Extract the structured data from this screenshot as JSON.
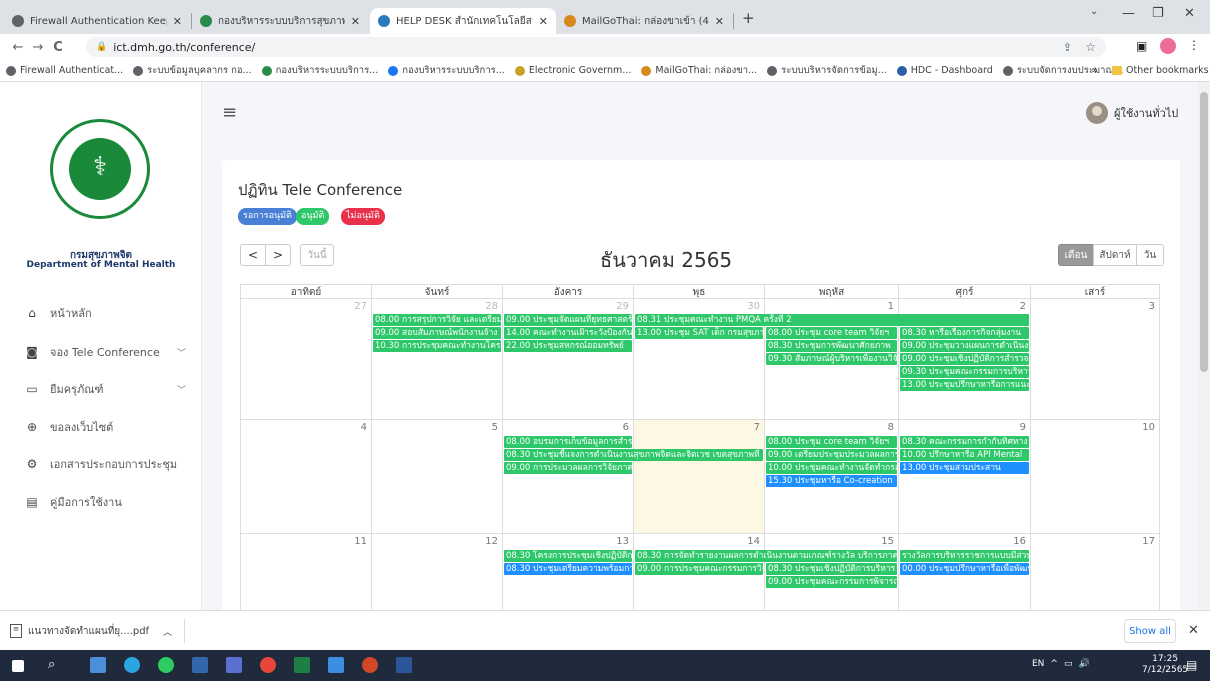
{
  "browser": {
    "tabs": [
      {
        "label": "Firewall Authentication Keepalive",
        "icon": "globe-icon",
        "active": false
      },
      {
        "label": "กองบริหารระบบบริการสุขภาพจิต",
        "icon": "site-icon",
        "active": false
      },
      {
        "label": "HELP DESK สำนักเทคโนโลยีสารสนเทศ",
        "icon": "helpdesk-icon",
        "active": true
      },
      {
        "label": "MailGoThai: กล่องขาเข้า (4)",
        "icon": "mail-icon",
        "active": false
      }
    ],
    "new_tab": "+",
    "url": "ict.dmh.go.th/conference/",
    "bookmarks": [
      "Firewall Authenticat...",
      "ระบบข้อมูลบุคลากร กอ...",
      "กองบริหารระบบบริการ...",
      "กองบริหารระบบบริการ...",
      "Electronic Governm...",
      "MailGoThai: กล่องขา...",
      "ระบบบริหารจัดการข้อมู...",
      "HDC - Dashboard",
      "ระบบจัดการงบประมาณ..."
    ],
    "bookmarks_more": "»",
    "other_bookmarks": "Other bookmarks"
  },
  "sidebar": {
    "dept_th": "กรมสุขภาพจิต",
    "dept_en": "Department of Mental Health",
    "items": [
      {
        "label": "หน้าหลัก",
        "icon": "home-icon",
        "has_sub": false
      },
      {
        "label": "จอง Tele Conference",
        "icon": "camera-icon",
        "has_sub": true
      },
      {
        "label": "ยืมครุภัณฑ์",
        "icon": "monitor-icon",
        "has_sub": true
      },
      {
        "label": "ขอลงเว็บไซต์",
        "icon": "web-icon",
        "has_sub": false
      },
      {
        "label": "เอกสารประกอบการประชุม",
        "icon": "gear-icon",
        "has_sub": false
      },
      {
        "label": "คู่มือการใช้งาน",
        "icon": "document-icon",
        "has_sub": false
      }
    ]
  },
  "header": {
    "menu_icon": "hamburger-icon",
    "user_label": "ผู้ใช้งานทั่วไป"
  },
  "calendar": {
    "title": "ปฏิทิน Tele Conference",
    "legend": [
      {
        "label": "รอการอนุมัติ",
        "color": "#4a7fd6"
      },
      {
        "label": "อนุมัติ",
        "color": "#2ec86a"
      },
      {
        "label": "ไม่อนุมัติ",
        "color": "#e8314a"
      }
    ],
    "prev": "<",
    "next": ">",
    "today_label": "วันนี้",
    "month_title": "ธันวาคม 2565",
    "views": [
      {
        "label": "เดือน",
        "active": true
      },
      {
        "label": "สัปดาห์",
        "active": false
      },
      {
        "label": "วัน",
        "active": false
      }
    ],
    "weekdays": [
      "อาทิตย์",
      "จันทร์",
      "อังคาร",
      "พุธ",
      "พฤหัส",
      "ศุกร์",
      "เสาร์"
    ],
    "weeks": [
      {
        "days": [
          {
            "n": "27",
            "other": true
          },
          {
            "n": "28",
            "other": true
          },
          {
            "n": "29",
            "other": true
          },
          {
            "n": "30",
            "other": true
          },
          {
            "n": "1"
          },
          {
            "n": "2"
          },
          {
            "n": "3"
          }
        ]
      },
      {
        "days": [
          {
            "n": "4"
          },
          {
            "n": "5"
          },
          {
            "n": "6"
          },
          {
            "n": "7",
            "today": true
          },
          {
            "n": "8"
          },
          {
            "n": "9"
          },
          {
            "n": "10"
          }
        ]
      },
      {
        "days": [
          {
            "n": "11"
          },
          {
            "n": "12"
          },
          {
            "n": "13"
          },
          {
            "n": "14"
          },
          {
            "n": "15"
          },
          {
            "n": "16"
          },
          {
            "n": "17"
          }
        ]
      }
    ],
    "events": [
      {
        "week": 0,
        "col": 1,
        "span": 1,
        "row": 0,
        "text": "08.00 การสรุปการวิจัย และเตรียม",
        "color": "g"
      },
      {
        "week": 0,
        "col": 2,
        "span": 1,
        "row": 0,
        "text": "09.00 ประชุมจัดแผนที่ยุทธศาสตร์",
        "color": "g"
      },
      {
        "week": 0,
        "col": 3,
        "span": 3,
        "row": 0,
        "text": "08.31 ประชุมคณะทำงาน PMQA ครั้งที่ 2",
        "color": "g"
      },
      {
        "week": 0,
        "col": 1,
        "span": 1,
        "row": 1,
        "text": "09.00 สอบสัมภาษณ์พนักงานจ้าง",
        "color": "g"
      },
      {
        "week": 0,
        "col": 2,
        "span": 1,
        "row": 1,
        "text": "14.00 คณะทำงานเฝ้าระวังป้องกัน",
        "color": "g"
      },
      {
        "week": 0,
        "col": 3,
        "span": 1,
        "row": 1,
        "text": "13.00 ประชุม SAT เด็ก กรมสุขภาพจิต",
        "color": "g"
      },
      {
        "week": 0,
        "col": 4,
        "span": 1,
        "row": 1,
        "text": "08.00 ประชุม core team วิจัยฯ",
        "color": "g"
      },
      {
        "week": 0,
        "col": 5,
        "span": 1,
        "row": 1,
        "text": "08.30 หารือเรื่องการกิจกลุ่มงาน",
        "color": "g"
      },
      {
        "week": 0,
        "col": 1,
        "span": 1,
        "row": 2,
        "text": "10.30 การประชุมคณะทำงานโครงการ",
        "color": "g"
      },
      {
        "week": 0,
        "col": 2,
        "span": 1,
        "row": 2,
        "text": "22.00 ประชุมสหกรณ์ออมทรัพย์",
        "color": "g"
      },
      {
        "week": 0,
        "col": 4,
        "span": 1,
        "row": 2,
        "text": "08.30 ประชุมการพัฒนาศักยภาพ",
        "color": "g"
      },
      {
        "week": 0,
        "col": 5,
        "span": 1,
        "row": 2,
        "text": "09.00 ประชุมวางแผนการดำเนินงาน",
        "color": "g"
      },
      {
        "week": 0,
        "col": 4,
        "span": 1,
        "row": 3,
        "text": "09.30 สัมภาษณ์ผู้บริหารเพื่องานวิจัย",
        "color": "g"
      },
      {
        "week": 0,
        "col": 5,
        "span": 1,
        "row": 3,
        "text": "09.00 ประชุมเชิงปฏิบัติการสำรวจ",
        "color": "g"
      },
      {
        "week": 0,
        "col": 5,
        "span": 1,
        "row": 4,
        "text": "09.30 ประชุมคณะกรรมการบริหาร",
        "color": "g"
      },
      {
        "week": 0,
        "col": 5,
        "span": 1,
        "row": 5,
        "text": "13.00 ประชุมปรึกษาหารือการแนะ",
        "color": "g"
      },
      {
        "week": 1,
        "col": 2,
        "span": 1,
        "row": 0,
        "text": "08.00 อบรมการเก็บข้อมูลการสำรวจ",
        "color": "g"
      },
      {
        "week": 1,
        "col": 4,
        "span": 1,
        "row": 0,
        "text": "08.00 ประชุม core team วิจัยฯ",
        "color": "g"
      },
      {
        "week": 1,
        "col": 5,
        "span": 1,
        "row": 0,
        "text": "08.30 คณะกรรมการกำกับทิศทาง",
        "color": "g"
      },
      {
        "week": 1,
        "col": 2,
        "span": 2,
        "row": 1,
        "text": "08.30 ประชุมชี้แจงการดำเนินงานสุขภาพจิตและจิตเวช เขตสุขภาพที่",
        "color": "g"
      },
      {
        "week": 1,
        "col": 4,
        "span": 1,
        "row": 1,
        "text": "09.00 เตรียมประชุมประมวลผลการ",
        "color": "g"
      },
      {
        "week": 1,
        "col": 5,
        "span": 1,
        "row": 1,
        "text": "10.00 ปรึกษาหารือ API Mental",
        "color": "g"
      },
      {
        "week": 1,
        "col": 2,
        "span": 1,
        "row": 2,
        "text": "09.00 การประมวลผลการวิจัยภาค",
        "color": "g"
      },
      {
        "week": 1,
        "col": 4,
        "span": 1,
        "row": 2,
        "text": "10.00 ประชุมคณะทำงานจัดทำกรอบ",
        "color": "g"
      },
      {
        "week": 1,
        "col": 5,
        "span": 1,
        "row": 2,
        "text": "13.00 ประชุมสามประสาน",
        "color": "b"
      },
      {
        "week": 1,
        "col": 4,
        "span": 1,
        "row": 3,
        "text": "15.30 ประชุมหารือ Co-creation",
        "color": "b"
      },
      {
        "week": 2,
        "col": 2,
        "span": 1,
        "row": 0,
        "text": "08.30 โครงการประชุมเชิงปฏิบัติการ",
        "color": "g"
      },
      {
        "week": 2,
        "col": 3,
        "span": 2,
        "row": 0,
        "text": "08.30 การจัดทำรายงานผลการดำเนินงานตามเกณฑ์รางวัล บริการภาครัฐ",
        "color": "g"
      },
      {
        "week": 2,
        "col": 5,
        "span": 1,
        "row": 0,
        "text": "รางวัลการบริหารราชการแบบมีส่วนร่วม",
        "color": "g"
      },
      {
        "week": 2,
        "col": 2,
        "span": 1,
        "row": 1,
        "text": "08.30 ประชุมเตรียมความพร้อมการ",
        "color": "b"
      },
      {
        "week": 2,
        "col": 3,
        "span": 1,
        "row": 1,
        "text": "09.00 การประชุมคณะกรรมการวิจัย",
        "color": "g"
      },
      {
        "week": 2,
        "col": 4,
        "span": 1,
        "row": 1,
        "text": "08.30 ประชุมเชิงปฏิบัติการบริหาร",
        "color": "g"
      },
      {
        "week": 2,
        "col": 5,
        "span": 1,
        "row": 1,
        "text": "00.00 ประชุมปรึกษาหารือเพื่อพัฒนา",
        "color": "b"
      },
      {
        "week": 2,
        "col": 4,
        "span": 1,
        "row": 2,
        "text": "09.00 ประชุมคณะกรรมการพิจารณา",
        "color": "g"
      }
    ]
  },
  "downloads": {
    "file": "แนวทางจัดทำแผนที่ยุ....pdf",
    "show_all": "Show all",
    "close": "✕"
  },
  "taskbar": {
    "lang": "EN",
    "time": "17:25",
    "date": "7/12/2565"
  }
}
